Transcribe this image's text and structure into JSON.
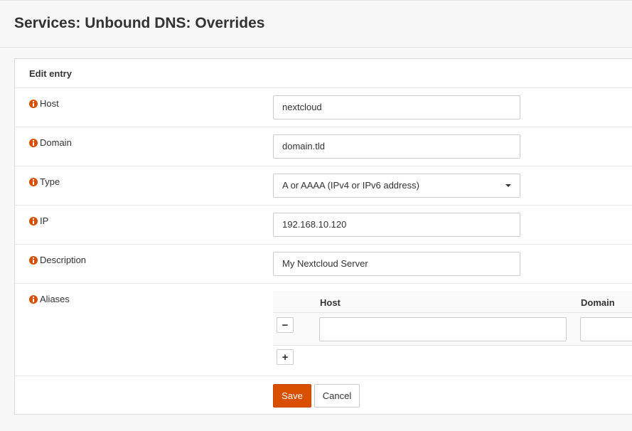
{
  "page": {
    "title": "Services: Unbound DNS: Overrides"
  },
  "panel": {
    "heading": "Edit entry"
  },
  "fields": {
    "host": {
      "label": "Host",
      "value": "nextcloud"
    },
    "domain": {
      "label": "Domain",
      "value": "domain.tld"
    },
    "type": {
      "label": "Type",
      "value": "A or AAAA (IPv4 or IPv6 address)"
    },
    "ip": {
      "label": "IP",
      "value": "192.168.10.120"
    },
    "description": {
      "label": "Description",
      "value": "My Nextcloud Server"
    },
    "aliases": {
      "label": "Aliases",
      "columns": {
        "host": "Host",
        "domain": "Domain"
      },
      "remove_label": "−",
      "add_label": "+"
    }
  },
  "actions": {
    "save": "Save",
    "cancel": "Cancel"
  },
  "colors": {
    "accent": "#d94f00"
  },
  "icons": {
    "field_info": "info-icon"
  }
}
